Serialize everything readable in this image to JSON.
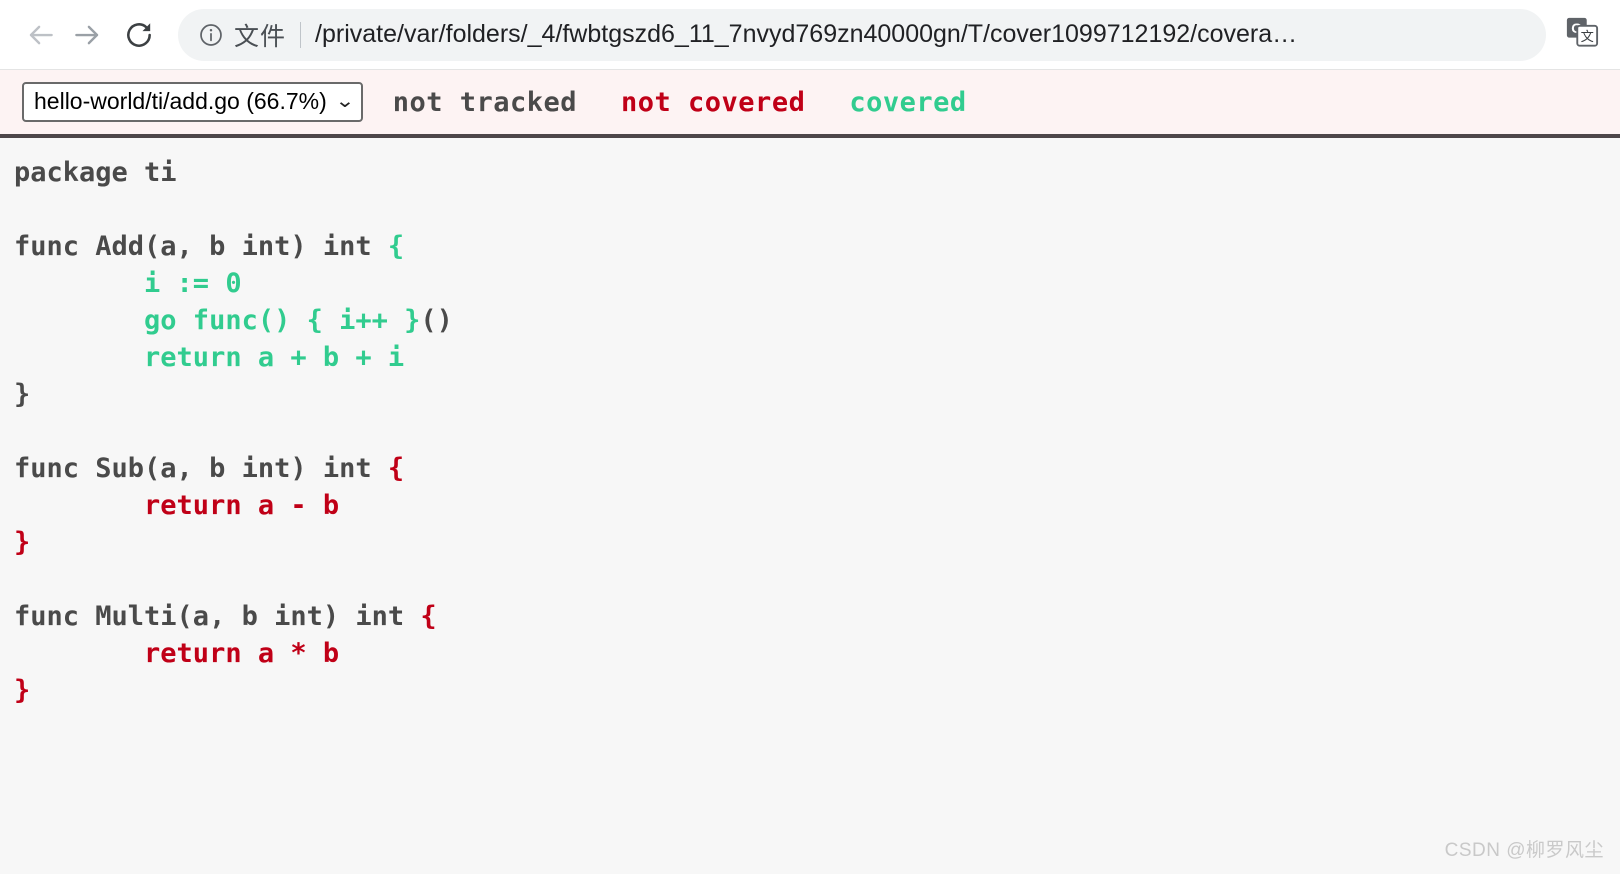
{
  "browser": {
    "back_icon": "arrow-left-icon",
    "forward_icon": "arrow-right-icon",
    "reload_icon": "reload-icon",
    "info_icon": "info-circle-icon",
    "scheme_label": "文件",
    "url": "/private/var/folders/_4/fwbtgszd6_11_7nvyd769zn40000gn/T/cover1099712192/covera…",
    "translate_icon": "google-translate-icon",
    "colors": {
      "omnibox_bg": "#f1f3f4",
      "url_text": "#202124",
      "icon_disabled": "#bdc1c6",
      "icon_enabled": "#5f6368"
    }
  },
  "coverage": {
    "file_select": {
      "value": "hello-world/ti/add.go (66.7%)",
      "caret_icon": "chevron-down-icon",
      "options": [
        "hello-world/ti/add.go (66.7%)"
      ]
    },
    "legend": [
      {
        "label": "not tracked",
        "color": "#4a4a4a",
        "key": "untracked"
      },
      {
        "label": "not covered",
        "color": "#c00017",
        "key": "uncovered"
      },
      {
        "label": "covered",
        "color": "#31cc8f",
        "key": "covered"
      }
    ],
    "header_bg": "#fdf3f3",
    "divider_color": "#4e4649",
    "code_bg": "#f7f7f7",
    "file_percent": "66.7%",
    "file_path": "hello-world/ti/add.go",
    "lines": [
      [
        {
          "t": "package ti",
          "c": 0
        }
      ],
      [
        {
          "t": "",
          "c": 0
        }
      ],
      [
        {
          "t": "func Add(a, b int) int ",
          "c": 0
        },
        {
          "t": "{",
          "c": 2
        }
      ],
      [
        {
          "t": "        i := 0",
          "c": 2
        }
      ],
      [
        {
          "t": "        go func() { i++ }",
          "c": 2
        },
        {
          "t": "()",
          "c": 0
        }
      ],
      [
        {
          "t": "        return a + b + i",
          "c": 2
        }
      ],
      [
        {
          "t": "}",
          "c": 0
        }
      ],
      [
        {
          "t": "",
          "c": 0
        }
      ],
      [
        {
          "t": "func Sub(a, b int) int ",
          "c": 0
        },
        {
          "t": "{",
          "c": 1
        }
      ],
      [
        {
          "t": "        return a - b",
          "c": 1
        }
      ],
      [
        {
          "t": "}",
          "c": 1
        }
      ],
      [
        {
          "t": "",
          "c": 0
        }
      ],
      [
        {
          "t": "func Multi(a, b int) int ",
          "c": 0
        },
        {
          "t": "{",
          "c": 1
        }
      ],
      [
        {
          "t": "        return a * b",
          "c": 1
        }
      ],
      [
        {
          "t": "}",
          "c": 1
        }
      ]
    ]
  },
  "watermark": {
    "text": "CSDN @柳罗风尘"
  }
}
